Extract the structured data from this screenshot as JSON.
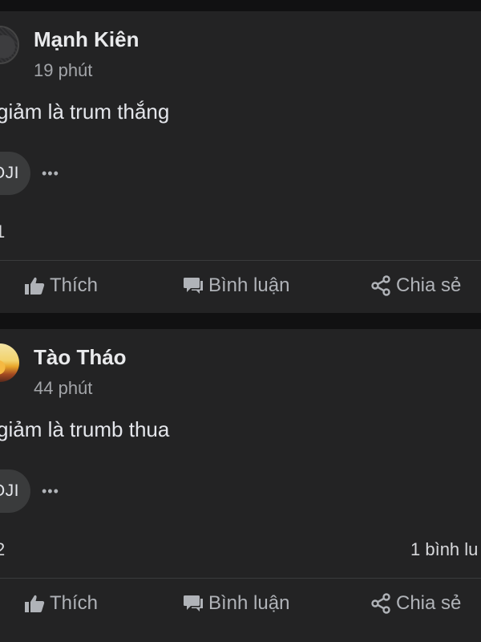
{
  "posts": [
    {
      "author": "Mạnh Kiên",
      "time": "19 phút",
      "content": "giảm là trum thắng",
      "emoji_label": "OJI",
      "more_label": "•••",
      "reaction_count": "1",
      "comment_count": "",
      "actions": {
        "like": "Thích",
        "comment": "Bình luận",
        "share": "Chia sẻ"
      }
    },
    {
      "author": "Tào Tháo",
      "time": "44 phút",
      "content": "giảm là trumb thua",
      "emoji_label": "OJI",
      "more_label": "•••",
      "reaction_count": "2",
      "comment_count": "1 bình lu",
      "actions": {
        "like": "Thích",
        "comment": "Bình luận",
        "share": "Chia sẻ"
      }
    }
  ],
  "icons": {
    "like": "thumbs-up-icon",
    "comment": "comment-icon",
    "share": "share-icon"
  },
  "colors": {
    "background": "#111112",
    "card": "#232324",
    "text_primary": "#e4e6eb",
    "text_secondary": "#b0b3b8"
  }
}
